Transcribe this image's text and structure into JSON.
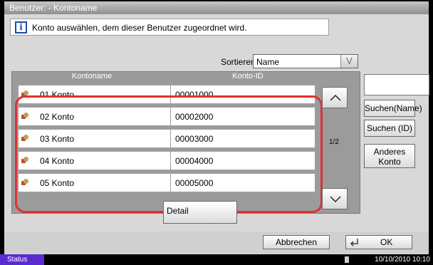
{
  "window": {
    "title": "Benutzer:  - Kontoname"
  },
  "info": {
    "icon": "info-icon",
    "text": "Konto auswählen, dem dieser Benutzer zugeordnet  wird."
  },
  "sort": {
    "label": "Sortieren",
    "value": "Name"
  },
  "table": {
    "headers": [
      "Kontoname",
      "Konto-ID"
    ],
    "rows": [
      {
        "name": "01  Konto",
        "id": "00001000"
      },
      {
        "name": "02  Konto",
        "id": "00002000"
      },
      {
        "name": "03  Konto",
        "id": "00003000"
      },
      {
        "name": "04  Konto",
        "id": "00004000"
      },
      {
        "name": "05  Konto",
        "id": "00005000"
      }
    ]
  },
  "pagination": {
    "indicator": "1/2"
  },
  "side_buttons": {
    "search_name": "Suchen(Name)",
    "search_id": "Suchen (ID)",
    "other_account": "Anderes Konto"
  },
  "detail_label": "Detail",
  "footer": {
    "cancel_label": "Abbrechen",
    "ok_label": "OK"
  },
  "status_bar": {
    "label": "Status",
    "datetime": "10/10/2010  10:10"
  },
  "colors": {
    "highlight": "#e03131",
    "status": "#5a2bd1",
    "info_icon": "#1e4e9c"
  }
}
